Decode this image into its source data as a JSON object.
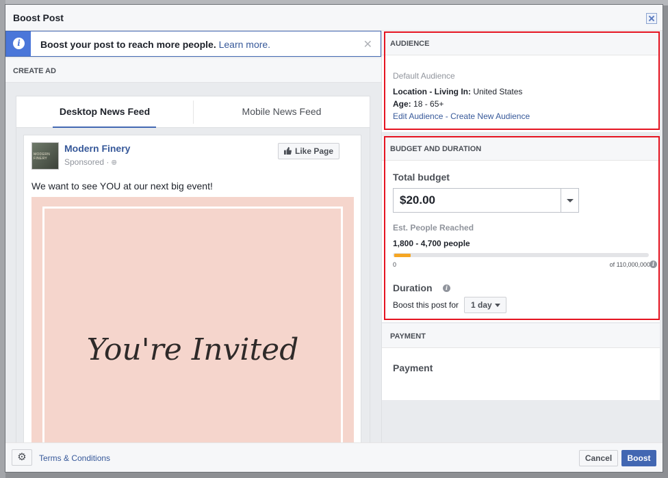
{
  "dialog": {
    "title": "Boost Post"
  },
  "banner": {
    "text": "Boost your post to reach more people.",
    "link": "Learn more.",
    "icon": "info-icon"
  },
  "create_ad": {
    "heading": "CREATE AD",
    "tabs": [
      {
        "label": "Desktop News Feed",
        "active": true
      },
      {
        "label": "Mobile News Feed",
        "active": false
      }
    ]
  },
  "post": {
    "page_name": "Modern Finery",
    "avatar_text": "MODERN FINERY",
    "sponsored": "Sponsored ·",
    "like_button": "Like Page",
    "message": "We want to see YOU at our next big event!",
    "image_text": "You're Invited"
  },
  "audience": {
    "heading": "AUDIENCE",
    "default_label": "Default Audience",
    "location_label": "Location - Living In:",
    "location_value": "United States",
    "age_label": "Age:",
    "age_value": "18 - 65+",
    "edit_link": "Edit Audience",
    "separator": "-",
    "create_link": "Create New Audience"
  },
  "budget": {
    "heading": "BUDGET AND DURATION",
    "total_label": "Total budget",
    "total_value": "$20.00",
    "reach_label": "Est. People Reached",
    "reach_value": "1,800 - 4,700 people",
    "reach_min": "0",
    "reach_max": "of 110,000,000",
    "reach_fraction": 0.065,
    "duration_label": "Duration",
    "boost_for_label": "Boost this post for",
    "duration_value": "1 day"
  },
  "payment": {
    "heading": "PAYMENT",
    "title": "Payment"
  },
  "footer": {
    "terms": "Terms & Conditions",
    "cancel": "Cancel",
    "boost": "Boost"
  },
  "colors": {
    "brand": "#4267b2",
    "link": "#365899",
    "highlight": "#e5121f",
    "reach_fill": "#f5a623"
  }
}
